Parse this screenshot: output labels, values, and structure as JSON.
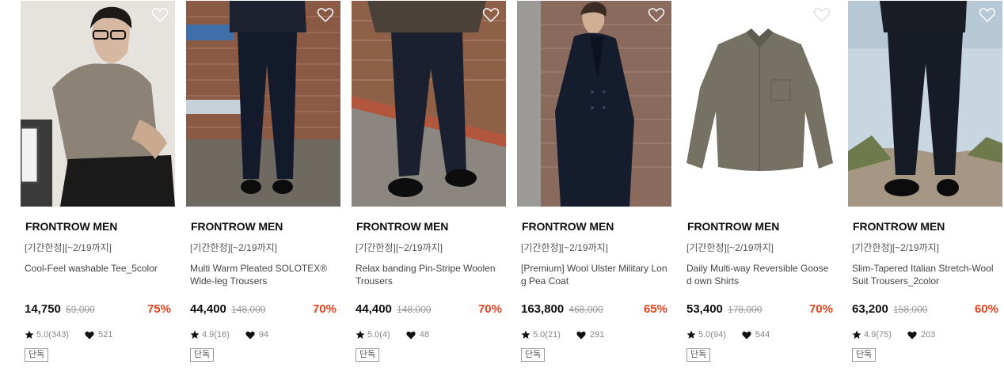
{
  "products": [
    {
      "brand": "FRONTROW MEN",
      "promo": "[기간한정][~2/19까지]",
      "name": "Cool-Feel washable Tee_5color",
      "price": "14,750",
      "original_price": "59,000",
      "discount": "75%",
      "rating": "5.0(343)",
      "likes": "521",
      "badge": "단독"
    },
    {
      "brand": "FRONTROW MEN",
      "promo": "[기간한정][~2/19까지]",
      "name": "Multi Warm Pleated SOLOTEX® Wide-leg Trousers",
      "price": "44,400",
      "original_price": "148,000",
      "discount": "70%",
      "rating": "4.9(16)",
      "likes": "94",
      "badge": "단독"
    },
    {
      "brand": "FRONTROW MEN",
      "promo": "[기간한정][~2/19까지]",
      "name": "Relax banding Pin-Stripe Woolen Trousers",
      "price": "44,400",
      "original_price": "148,000",
      "discount": "70%",
      "rating": "5.0(4)",
      "likes": "48",
      "badge": "단독"
    },
    {
      "brand": "FRONTROW MEN",
      "promo": "[기간한정][~2/19까지]",
      "name": "[Premium] Wool Ulster Military Long Pea Coat",
      "price": "163,800",
      "original_price": "468,000",
      "discount": "65%",
      "rating": "5.0(21)",
      "likes": "291",
      "badge": "단독"
    },
    {
      "brand": "FRONTROW MEN",
      "promo": "[기간한정][~2/19까지]",
      "name": "Daily Multi-way Reversible Goosed own Shirts",
      "price": "53,400",
      "original_price": "178,000",
      "discount": "70%",
      "rating": "5.0(94)",
      "likes": "544",
      "badge": "단독"
    },
    {
      "brand": "FRONTROW MEN",
      "promo": "[기간한정][~2/19까지]",
      "name": "Slim-Tapered Italian Stretch-Wool Suit Trousers_2color",
      "price": "63,200",
      "original_price": "158,000",
      "discount": "60%",
      "rating": "4.9(75)",
      "likes": "203",
      "badge": "단독"
    }
  ],
  "colors": {
    "discount": "#e8431f",
    "text": "#111111",
    "muted": "#888888"
  }
}
